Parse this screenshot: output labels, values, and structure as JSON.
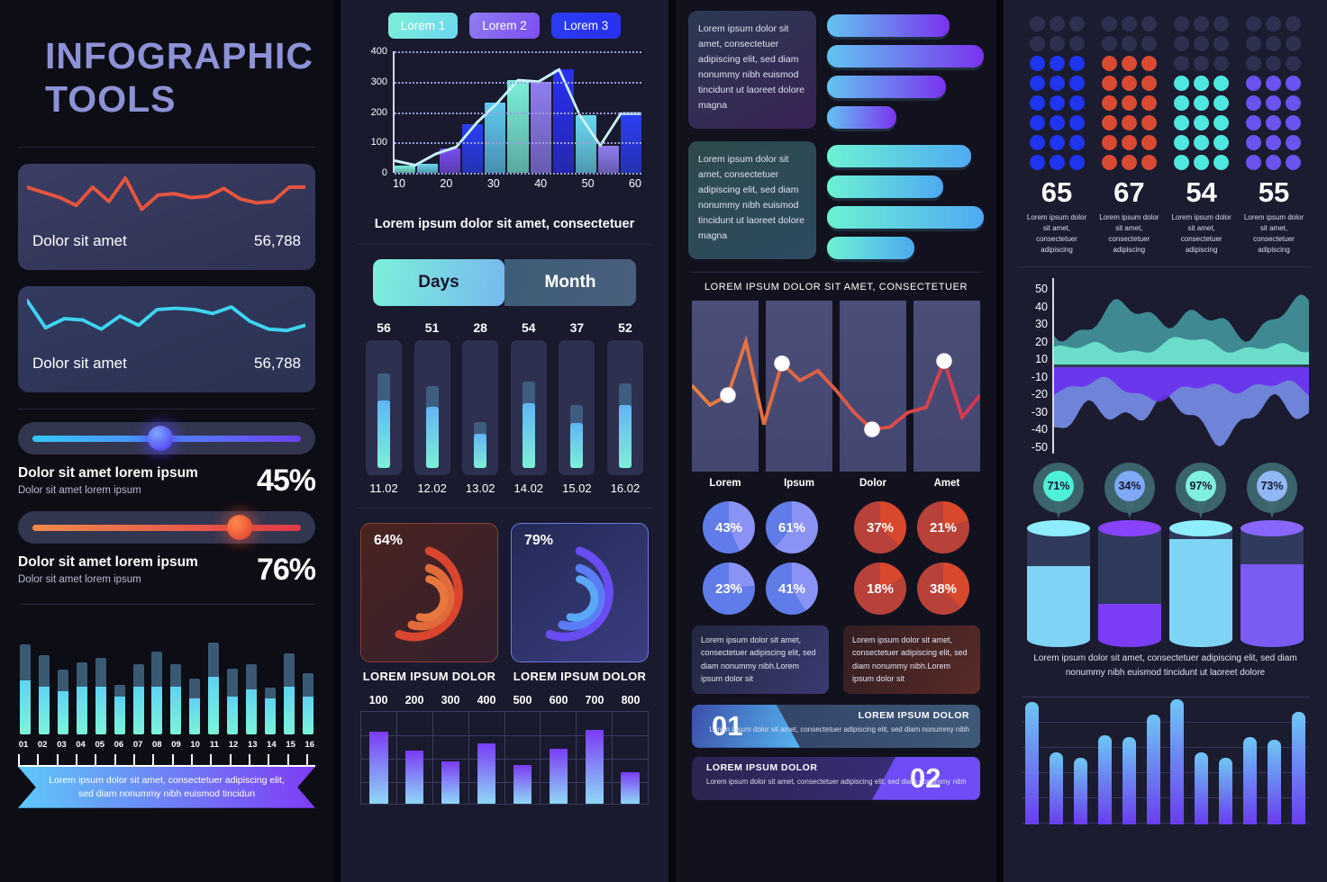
{
  "col1": {
    "title_line1": "INFOGRAPHIC",
    "title_line2": "TOOLS",
    "stat1": {
      "label": "Dolor sit amet",
      "value": "56,788"
    },
    "stat2": {
      "label": "Dolor sit amet",
      "value": "56,788"
    },
    "slider1": {
      "title": "Dolor sit amet lorem ipsum",
      "sub": "Dolor sit amet lorem ipsum",
      "percent": "45%",
      "value": 45
    },
    "slider2": {
      "title": "Dolor sit amet lorem ipsum",
      "sub": "Dolor sit amet lorem ipsum",
      "percent": "76%",
      "value": 76
    },
    "ribbon_text": "Lorem ipsum dolor sit amet, consectetuer adipiscing elit, sed diam nonummy nibh euismod tincidun"
  },
  "col2": {
    "tabs": [
      "Lorem 1",
      "Lorem 2",
      "Lorem 3"
    ],
    "chart1_caption": "Lorem ipsum dolor sit amet, consectetuer",
    "toggle": {
      "on": "Days",
      "off": "Month"
    },
    "donut_left": {
      "percent": "64%",
      "label": "LOREM IPSUM DOLOR"
    },
    "donut_right": {
      "percent": "79%",
      "label": "LOREM IPSUM DOLOR"
    }
  },
  "col3": {
    "card1_text": "Lorem ipsum dolor sit amet, consectetuer adipiscing elit, sed diam nonummy nibh euismod tincidunt ut laoreet dolore magna",
    "card2_text": "Lorem ipsum dolor sit amet, consectetuer adipiscing elit, sed diam nonummy nibh euismod tincidunt ut laoreet dolore magna",
    "linechart_title": "LOREM IPSUM DOLOR SIT AMET, CONSECTETUER",
    "note_blue": "Lorem ipsum dolor sit amet, consectetuer adipiscing elit, sed diam nonummy nibh.Lorem ipsum dolor sit",
    "note_red": "Lorem ipsum dolor sit amet, consectetuer adipiscing elit, sed diam nonummy nibh.Lorem ipsum dolor sit",
    "banner1": {
      "number": "01",
      "heading": "LOREM IPSUM DOLOR",
      "body": "Lorem ipsum dolor sit amet, consectetuer adipiscing elit, sed diam nonummy nibh"
    },
    "banner2": {
      "number": "02",
      "heading": "LOREM IPSUM DOLOR",
      "body": "Lorem ipsum dolor sit amet, consectetuer adipiscing elit, sed diam nonummy nibh"
    }
  },
  "col4": {
    "cylinder_caption": "Lorem ipsum dolor sit amet, consectetuer adipiscing elit, sed diam nonummy nibh euismod tincidunt ut laoreet dolore"
  },
  "chart_data": [
    {
      "id": "c1-sparkline-red",
      "type": "line",
      "title": "Dolor sit amet",
      "values": [
        58,
        50,
        42,
        30,
        58,
        36,
        72,
        24,
        46,
        48,
        42,
        44,
        56,
        40,
        34,
        36,
        58,
        58
      ],
      "ylim": [
        0,
        80
      ],
      "grid": false,
      "legend": null,
      "color": "#e8553f"
    },
    {
      "id": "c1-sparkline-blue",
      "type": "line",
      "title": "Dolor sit amet",
      "values": [
        72,
        30,
        44,
        42,
        28,
        48,
        34,
        58,
        60,
        58,
        52,
        62,
        40,
        28,
        26,
        34
      ],
      "ylim": [
        0,
        80
      ],
      "grid": false,
      "legend": null,
      "color": "#3fd4f0"
    },
    {
      "id": "c1-minibars",
      "type": "bar",
      "title": "",
      "categories": [
        "01",
        "02",
        "03",
        "04",
        "05",
        "06",
        "07",
        "08",
        "09",
        "10",
        "11",
        "12",
        "13",
        "14",
        "15",
        "16"
      ],
      "series": [
        {
          "name": "total",
          "values": [
            100,
            88,
            72,
            80,
            85,
            55,
            78,
            92,
            78,
            62,
            102,
            73,
            78,
            52,
            90,
            68
          ]
        },
        {
          "name": "filled",
          "values": [
            60,
            53,
            48,
            53,
            53,
            42,
            53,
            53,
            53,
            40,
            64,
            42,
            50,
            40,
            53,
            42
          ]
        }
      ],
      "ylim": [
        0,
        110
      ],
      "grid": false
    },
    {
      "id": "c2-bar-line",
      "type": "bar",
      "title": "Lorem ipsum dolor sit amet, consectetuer",
      "xlabel": "",
      "ylabel": "",
      "categories": [
        10,
        20,
        30,
        40,
        50,
        60
      ],
      "xticks": [
        "10",
        "20",
        "30",
        "40",
        "50",
        "60"
      ],
      "yticks": [
        "0",
        "100",
        "200",
        "300",
        "400"
      ],
      "ylim": [
        0,
        400
      ],
      "grid": true,
      "bar_values": [
        25,
        30,
        80,
        160,
        230,
        305,
        300,
        340,
        190,
        90,
        195
      ],
      "bar_colors": [
        "#7bf0d8",
        "#6ad8f0",
        "#7a4df2",
        "#2a3ef5",
        "#5fc9f0",
        "#7bf0d8",
        "#8f7df0",
        "#2a2ff0",
        "#6ad8f0",
        "#8f7df0",
        "#2a3ef5"
      ],
      "line_values": [
        40,
        25,
        62,
        85,
        165,
        230,
        305,
        300,
        340,
        190,
        90,
        195,
        195
      ]
    },
    {
      "id": "c2-daybars",
      "type": "bar",
      "title": "Days",
      "categories": [
        "11.02",
        "12.02",
        "13.02",
        "14.02",
        "15.02",
        "16.02"
      ],
      "values": [
        56,
        51,
        28,
        54,
        37,
        52
      ],
      "capacity": [
        78,
        68,
        38,
        72,
        52,
        70
      ],
      "ylim": [
        0,
        100
      ],
      "grid": false
    },
    {
      "id": "c2-donut-left",
      "type": "pie",
      "title": "LOREM IPSUM DOLOR",
      "values": [
        64
      ],
      "labels": [
        "64%"
      ],
      "color": "#e0553a"
    },
    {
      "id": "c2-donut-right",
      "type": "pie",
      "title": "LOREM IPSUM DOLOR",
      "values": [
        79
      ],
      "labels": [
        "79%"
      ],
      "color": "#6b5cf0"
    },
    {
      "id": "c2-gridchart",
      "type": "bar",
      "title": "",
      "categories": [
        "100",
        "200",
        "300",
        "400",
        "500",
        "600",
        "700",
        "800"
      ],
      "values": [
        78,
        58,
        46,
        66,
        42,
        60,
        80,
        34
      ],
      "ylim": [
        0,
        100
      ],
      "grid": true
    },
    {
      "id": "c3-hbars-purple",
      "type": "bar",
      "orientation": "horizontal",
      "title": "",
      "values": [
        78,
        100,
        76,
        44
      ],
      "ylim": [
        0,
        100
      ],
      "grid": false,
      "color": "#7a33f0"
    },
    {
      "id": "c3-hbars-teal",
      "type": "bar",
      "orientation": "horizontal",
      "title": "",
      "values": [
        92,
        74,
        100,
        56
      ],
      "ylim": [
        0,
        100
      ],
      "grid": false,
      "color": "#4fa9f2"
    },
    {
      "id": "c3-linechart",
      "type": "line",
      "title": "LOREM IPSUM DOLOR SIT AMET, CONSECTETUER",
      "categories": [
        "Lorem",
        "Ipsum",
        "Dolor",
        "Amet"
      ],
      "values": [
        52,
        36,
        44,
        88,
        20,
        70,
        56,
        64,
        48,
        30,
        16,
        18,
        30,
        34,
        72,
        26,
        44
      ],
      "markers": [
        {
          "index": 2,
          "value": 44
        },
        {
          "index": 5,
          "value": 70
        },
        {
          "index": 10,
          "value": 16
        },
        {
          "index": 14,
          "value": 72
        }
      ],
      "ylim": [
        0,
        100
      ],
      "grid": false,
      "color": "#e0604a"
    },
    {
      "id": "c3-donut-pcts",
      "type": "pie",
      "title": "",
      "blue": [
        43,
        61,
        23,
        41
      ],
      "red": [
        37,
        21,
        18,
        38
      ],
      "labels_blue": [
        "43%",
        "61%",
        "23%",
        "41%"
      ],
      "labels_red": [
        "37%",
        "21%",
        "18%",
        "38%"
      ]
    },
    {
      "id": "c4-dotmatrix",
      "type": "bar",
      "title": "",
      "categories": [
        "65",
        "67",
        "54",
        "55"
      ],
      "values": [
        65,
        67,
        54,
        55
      ],
      "filled_dots": [
        18,
        18,
        15,
        15
      ],
      "total_dots": [
        24,
        24,
        24,
        24
      ],
      "colors": [
        "#1f35f0",
        "#d94a32",
        "#4fe8e0",
        "#6a53ef"
      ],
      "captions": [
        "Lorem ipsum dolor sit amet, consectetuer adipiscing",
        "Lorem ipsum dolor sit amet, consectetuer adipiscing",
        "Lorem ipsum dolor sit amet, consectetuer adipiscing",
        "Lorem ipsum dolor sit amet, consectetuer adipiscing"
      ]
    },
    {
      "id": "c4-streamgraph",
      "type": "area",
      "title": "",
      "yticks": [
        "50",
        "40",
        "30",
        "20",
        "10",
        "-10",
        "-20",
        "-30",
        "-40",
        "-50"
      ],
      "ylim": [
        -50,
        50
      ],
      "grid": false,
      "series": [
        {
          "name": "upper-outer",
          "color": "#3f8a8f"
        },
        {
          "name": "upper-inner",
          "color": "#6fe0d0"
        },
        {
          "name": "lower-outer",
          "color": "#6f84d8"
        },
        {
          "name": "lower-inner",
          "color": "#6a2ff0"
        }
      ]
    },
    {
      "id": "c4-cylinders",
      "type": "bar",
      "title": "",
      "categories": [
        "71%",
        "34%",
        "97%",
        "73%"
      ],
      "values": [
        71,
        34,
        97,
        73
      ],
      "colors": [
        "#7fd4f5",
        "#7a3cf5",
        "#7fd4f5",
        "#7a5cf5"
      ],
      "ylim": [
        0,
        100
      ],
      "grid": false
    },
    {
      "id": "c4-barchart",
      "type": "bar",
      "title": "",
      "values": [
        96,
        56,
        52,
        70,
        68,
        86,
        98,
        56,
        52,
        68,
        66,
        88
      ],
      "ylim": [
        0,
        100
      ],
      "grid": true
    }
  ]
}
